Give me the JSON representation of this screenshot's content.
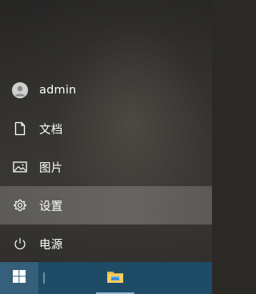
{
  "start_menu": {
    "items": [
      {
        "label": "admin",
        "icon": "user-avatar-icon"
      },
      {
        "label": "文档",
        "icon": "document-icon"
      },
      {
        "label": "图片",
        "icon": "picture-icon"
      },
      {
        "label": "设置",
        "icon": "gear-icon",
        "highlighted": true
      },
      {
        "label": "电源",
        "icon": "power-icon"
      }
    ]
  },
  "taskbar": {
    "start_icon": "windows-logo-icon",
    "pinned": [
      {
        "icon": "file-explorer-icon",
        "active": true
      }
    ],
    "accent_color": "#1e4b66"
  }
}
